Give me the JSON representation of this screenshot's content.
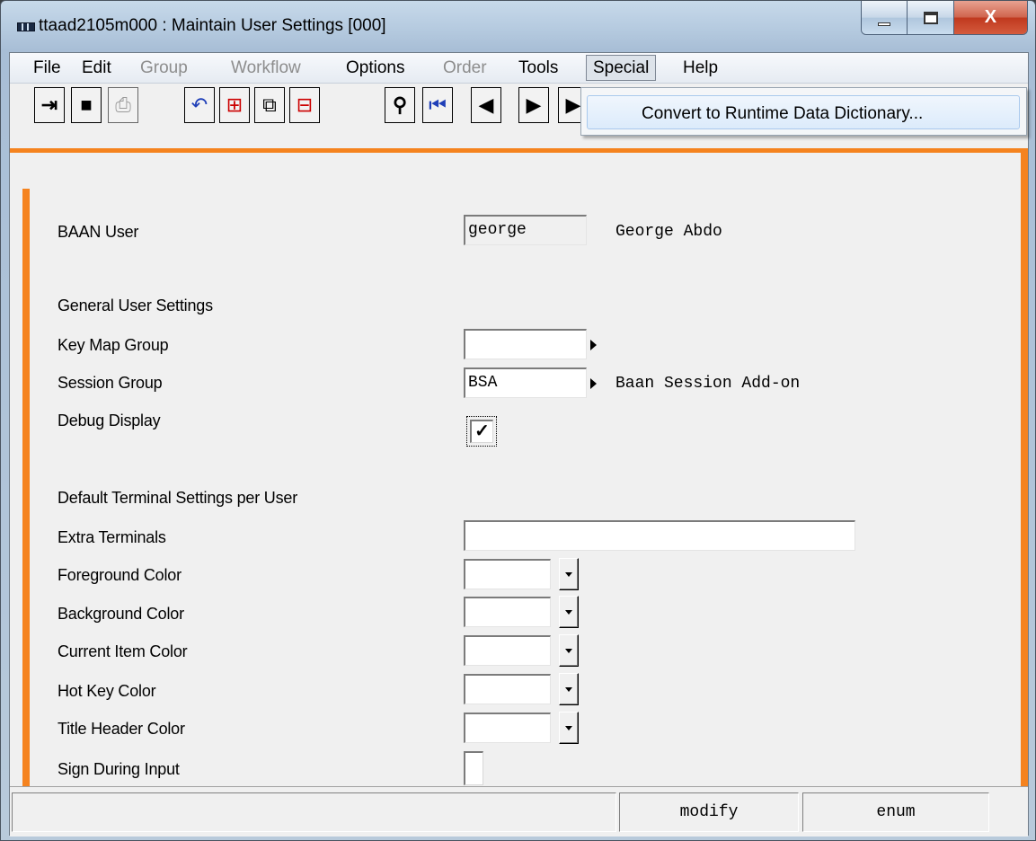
{
  "window": {
    "title": "ttaad2105m000 : Maintain User Settings [000]",
    "close_glyph": "X"
  },
  "menubar": {
    "items": [
      {
        "label": "File",
        "state": "enabled"
      },
      {
        "label": "Edit",
        "state": "enabled"
      },
      {
        "label": "Group",
        "state": "disabled"
      },
      {
        "label": "Workflow",
        "state": "disabled"
      },
      {
        "label": "Options",
        "state": "enabled"
      },
      {
        "label": "Order",
        "state": "disabled"
      },
      {
        "label": "Tools",
        "state": "enabled"
      },
      {
        "label": "Special",
        "state": "open"
      },
      {
        "label": "Help",
        "state": "enabled"
      }
    ]
  },
  "toolbar": {
    "buttons": [
      {
        "name": "exit-icon",
        "glyph": "⇥"
      },
      {
        "name": "save-icon",
        "glyph": "■"
      },
      {
        "name": "print-icon",
        "glyph": "⎙"
      },
      {
        "name": "undo-icon",
        "glyph": "↶"
      },
      {
        "name": "insert-record-icon",
        "glyph": "⊞"
      },
      {
        "name": "copy-icon",
        "glyph": "⧉"
      },
      {
        "name": "delete-record-icon",
        "glyph": "⊟"
      },
      {
        "name": "find-icon",
        "glyph": "⚲"
      },
      {
        "name": "first-record-icon",
        "glyph": "⏮"
      },
      {
        "name": "previous-record-icon",
        "glyph": "◀"
      },
      {
        "name": "next-record-icon",
        "glyph": "▶"
      },
      {
        "name": "last-record-icon",
        "glyph": "▶"
      }
    ]
  },
  "special_menu": {
    "items": [
      "Convert to Runtime Data Dictionary..."
    ]
  },
  "form": {
    "baan_user": {
      "label": "BAAN User",
      "value": "george",
      "description": "George Abdo"
    },
    "general_heading": "General User Settings",
    "key_map_group": {
      "label": "Key Map Group",
      "value": ""
    },
    "session_group": {
      "label": "Session Group",
      "value": "BSA",
      "description": "Baan Session Add-on"
    },
    "debug_display": {
      "label": "Debug Display",
      "checked": true,
      "glyph": "✓"
    },
    "terminal_heading": "Default Terminal Settings per User",
    "extra_terminals": {
      "label": "Extra Terminals",
      "value": ""
    },
    "foreground_color": {
      "label": "Foreground Color",
      "value": ""
    },
    "background_color": {
      "label": "Background Color",
      "value": ""
    },
    "current_item_color": {
      "label": "Current Item Color",
      "value": ""
    },
    "hot_key_color": {
      "label": "Hot Key Color",
      "value": ""
    },
    "title_header_color": {
      "label": "Title Header Color",
      "value": ""
    },
    "sign_during_input": {
      "label": "Sign During Input",
      "checked": false
    }
  },
  "statusbar": {
    "message": "",
    "mode": "modify",
    "field_type": "enum"
  },
  "colors": {
    "accent": "#f5831f",
    "panel": "#f0f0f0",
    "close_button": "#c7432a"
  }
}
